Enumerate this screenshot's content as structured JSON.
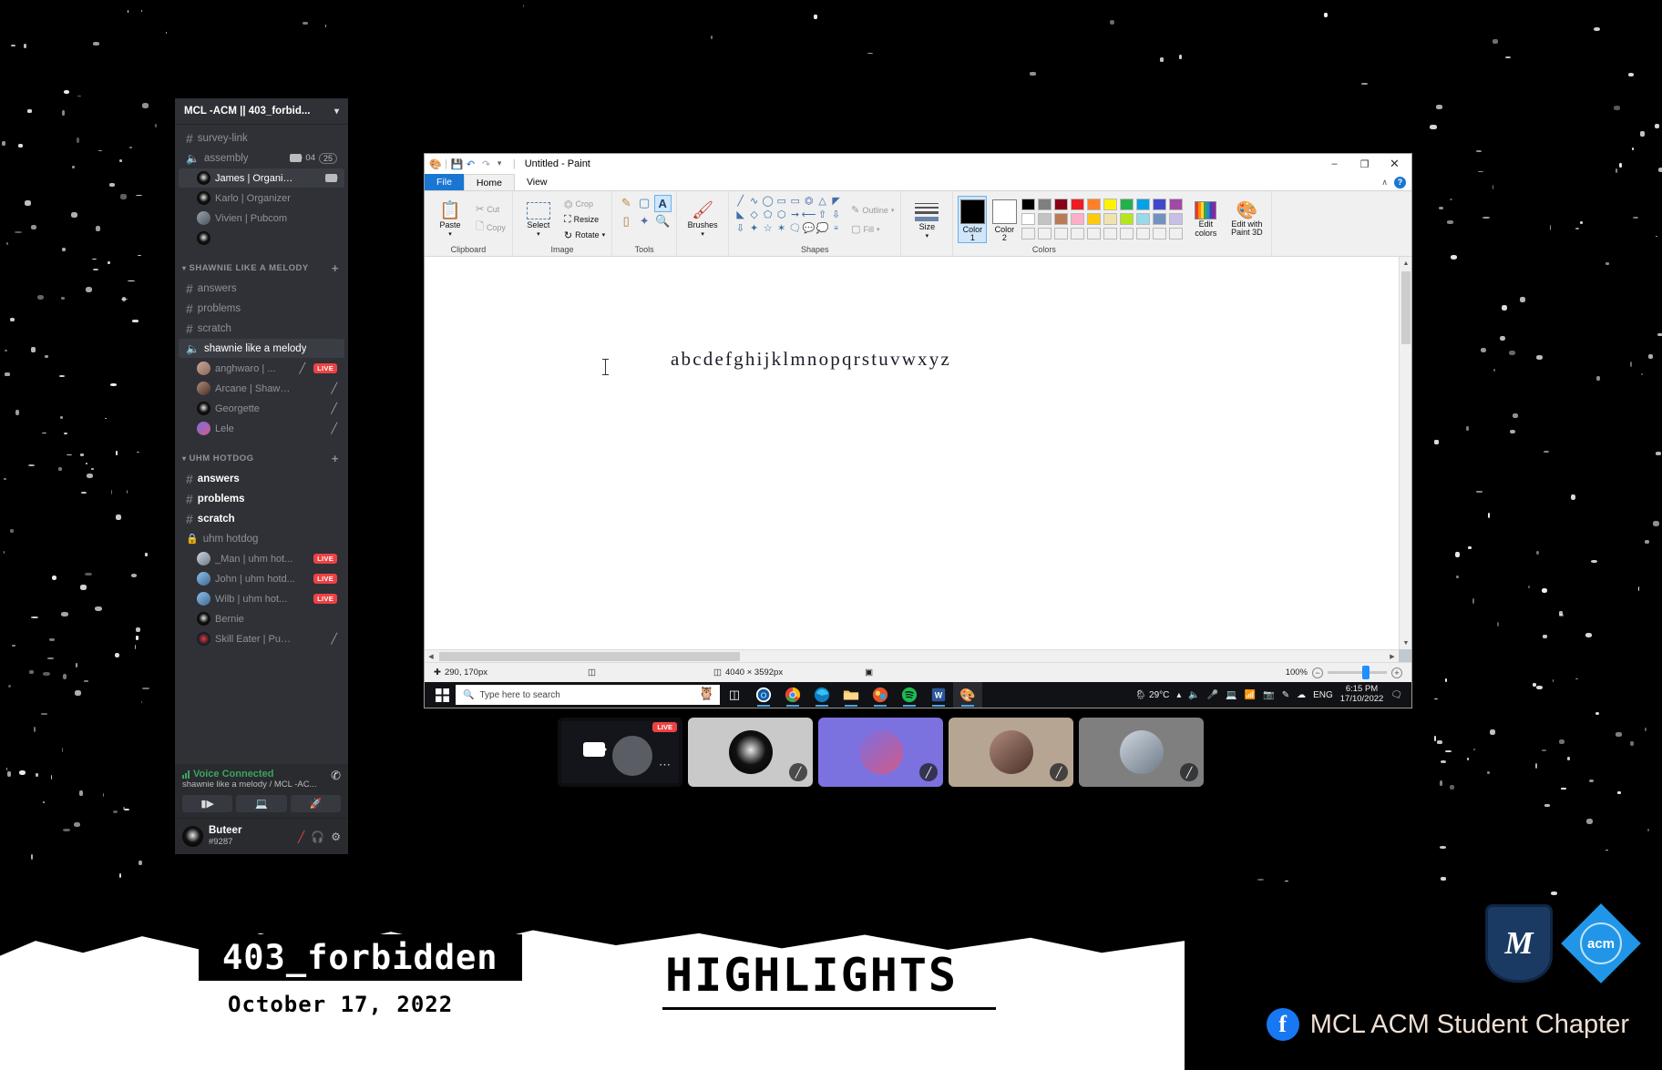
{
  "discord": {
    "server_title": "MCL -ACM || 403_forbid...",
    "top_channels": [
      {
        "name": "survey-link",
        "type": "text"
      },
      {
        "name": "assembly",
        "type": "voice",
        "cam_count": "04",
        "user_count": "25"
      }
    ],
    "assembly_members": [
      {
        "name": "James | Organizer",
        "avatar": "moth",
        "selected": true,
        "camera": true
      },
      {
        "name": "Karlo | Organizer",
        "avatar": "moth"
      },
      {
        "name": "Vivien | Pubcom",
        "avatar": "p4"
      },
      {
        "name": "",
        "avatar": "moth"
      }
    ],
    "categories": [
      {
        "label": "SHAWNIE LIKE A MELODY",
        "channels": [
          {
            "name": "answers",
            "type": "text"
          },
          {
            "name": "problems",
            "type": "text"
          },
          {
            "name": "scratch",
            "type": "text"
          },
          {
            "name": "shawnie like a melody",
            "type": "voice",
            "selected": true
          }
        ],
        "members": [
          {
            "name": "anghwaro | ...",
            "avatar": "p1",
            "muted": true,
            "live": "LIVE"
          },
          {
            "name": "Arcane | Shawnie Li...",
            "avatar": "p2",
            "muted": true
          },
          {
            "name": "Georgette",
            "avatar": "moth",
            "muted": true
          },
          {
            "name": "Lele",
            "avatar": "p3",
            "muted": true
          }
        ]
      },
      {
        "label": "UHM HOTDOG",
        "channels": [
          {
            "name": "answers",
            "type": "text",
            "unread": true
          },
          {
            "name": "problems",
            "type": "text",
            "unread": true
          },
          {
            "name": "scratch",
            "type": "text",
            "unread": true
          },
          {
            "name": "uhm hotdog",
            "type": "locked-voice"
          }
        ],
        "members": [
          {
            "name": "_Man | uhm hot...",
            "avatar": "p5",
            "live": "LIVE"
          },
          {
            "name": "John | uhm hotd...",
            "avatar": "p6",
            "live": "LIVE"
          },
          {
            "name": "Wilb | uhm hot...",
            "avatar": "p6",
            "live": "LIVE"
          },
          {
            "name": "Bernie",
            "avatar": "moth"
          },
          {
            "name": "Skill Eater | Pubcom",
            "avatar": "p7",
            "muted": true
          }
        ]
      }
    ],
    "voice_panel": {
      "status": "Voice Connected",
      "channel_path": "shawnie like a melody / MCL -AC...",
      "buttons": [
        "video-button",
        "screenshare-button",
        "activities-button"
      ]
    },
    "user": {
      "name": "Buteer",
      "tag": "#9287"
    }
  },
  "paint": {
    "window_title": "Untitled - Paint",
    "quick_access": [
      "paint-icon",
      "save-icon",
      "undo-icon",
      "redo-icon",
      "customize-icon"
    ],
    "window_controls": {
      "minimize": "–",
      "maximize": "❐",
      "close": "✕"
    },
    "ribbon_collapse": "∧",
    "help": "?",
    "tabs": [
      {
        "label": "File",
        "kind": "file"
      },
      {
        "label": "Home",
        "kind": "active"
      },
      {
        "label": "View",
        "kind": "normal"
      }
    ],
    "groups": {
      "clipboard": {
        "label": "Clipboard",
        "paste": "Paste",
        "cut": "Cut",
        "copy": "Copy"
      },
      "image": {
        "label": "Image",
        "select": "Select",
        "crop": "Crop",
        "resize": "Resize",
        "rotate": "Rotate"
      },
      "tools": {
        "label": "Tools",
        "items": [
          "pencil-icon",
          "fill-icon",
          "text-icon",
          "eraser-icon",
          "color-picker-icon",
          "magnifier-icon"
        ],
        "selected": "text-icon"
      },
      "brushes": {
        "label": "Brushes"
      },
      "shapes": {
        "label": "Shapes",
        "outline": "Outline",
        "fill": "Fill"
      },
      "size": {
        "label": "Size"
      },
      "colors": {
        "label": "Colors",
        "color1_label": "Color 1",
        "color2_label": "Color 2",
        "color1_value": "#000000",
        "color2_value": "#ffffff",
        "row1": [
          "#000000",
          "#7f7f7f",
          "#880015",
          "#ed1c24",
          "#ff7f27",
          "#fff200",
          "#22b14c",
          "#00a2e8",
          "#3f48cc",
          "#a349a4"
        ],
        "row2": [
          "#ffffff",
          "#c3c3c3",
          "#b97a57",
          "#ffaec9",
          "#ffc90e",
          "#efe4b0",
          "#b5e61d",
          "#99d9ea",
          "#7092be",
          "#c8bfe7"
        ],
        "edit_colors": "Edit colors",
        "paint3d": "Edit with Paint 3D"
      }
    },
    "canvas_text": "abcdefghijklmnopqrstuvwxyz",
    "status": {
      "cursor_position": "290, 170px",
      "selection_size": "",
      "image_size": "4040 × 3592px",
      "zoom_level": "100%"
    }
  },
  "taskbar": {
    "search_placeholder": "Type here to search",
    "apps": [
      "task-view-icon",
      "outlook-icon",
      "chrome-icon",
      "edge-icon",
      "file-explorer-icon",
      "photos-icon",
      "spotify-icon",
      "word-icon",
      "paint-icon"
    ],
    "tray": {
      "weather": "29°C",
      "language": "ENG",
      "time": "6:15 PM",
      "date": "17/10/2022",
      "icons": [
        "chevron-up-icon",
        "volume-icon",
        "mic-icon",
        "display-icon",
        "wifi-icon",
        "camera-icon",
        "pen-icon",
        "onedrive-icon",
        "action-center-icon"
      ]
    }
  },
  "tiles": [
    {
      "kind": "screenshare",
      "badge": "LIVE",
      "bg": "#0e0e12"
    },
    {
      "kind": "avatar",
      "bg": "#c9c9c9",
      "avatar": "moth",
      "muted": true
    },
    {
      "kind": "avatar",
      "bg": "#7b72e0",
      "avatar": "p3",
      "muted": true
    },
    {
      "kind": "avatar",
      "bg": "#b7a593",
      "avatar": "p2",
      "muted": true
    },
    {
      "kind": "avatar",
      "bg": "#7f7f7f",
      "avatar": "p5",
      "muted": true
    }
  ],
  "banner": {
    "event_tag": "403_forbidden",
    "event_date": "October 17, 2022",
    "section_title": "HIGHLIGHTS",
    "org_name": "MCL ACM Student Chapter",
    "acm_logo_text": "acm",
    "mcl_logo_text": "M",
    "facebook_glyph": "f"
  }
}
